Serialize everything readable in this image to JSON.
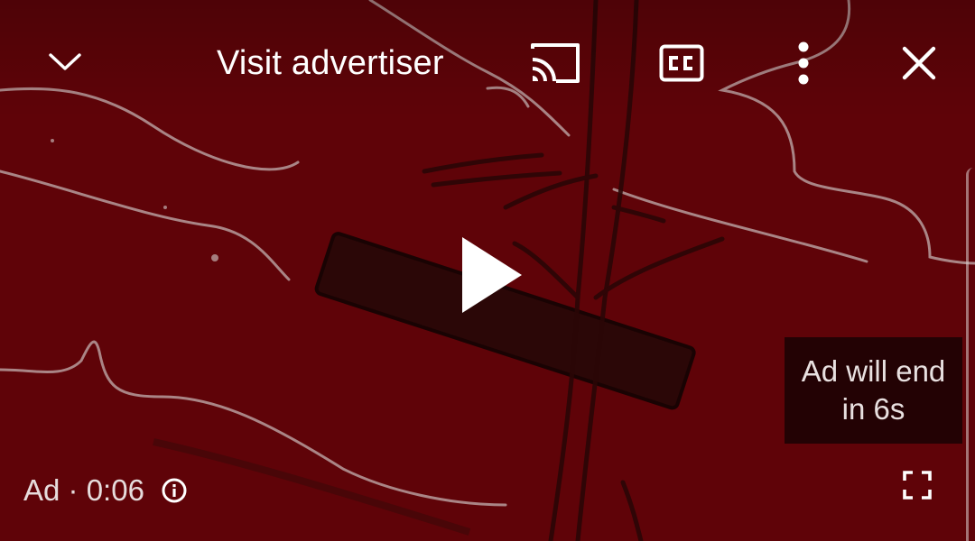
{
  "player": {
    "background_color": "#5f0308",
    "top_bar": {
      "collapse_icon": "chevron-down-icon",
      "visit_advertiser_label": "Visit advertiser",
      "cast_icon": "cast-icon",
      "captions_icon": "closed-captions-icon",
      "more_icon": "more-vert-icon",
      "close_icon": "close-icon"
    },
    "center": {
      "play_icon": "play-icon"
    },
    "ad_countdown": {
      "line1": "Ad will end",
      "line2": "in 6s"
    },
    "bottom_bar": {
      "ad_label": "Ad · 0:06",
      "info_icon": "info-icon",
      "fullscreen_icon": "fullscreen-icon"
    }
  }
}
